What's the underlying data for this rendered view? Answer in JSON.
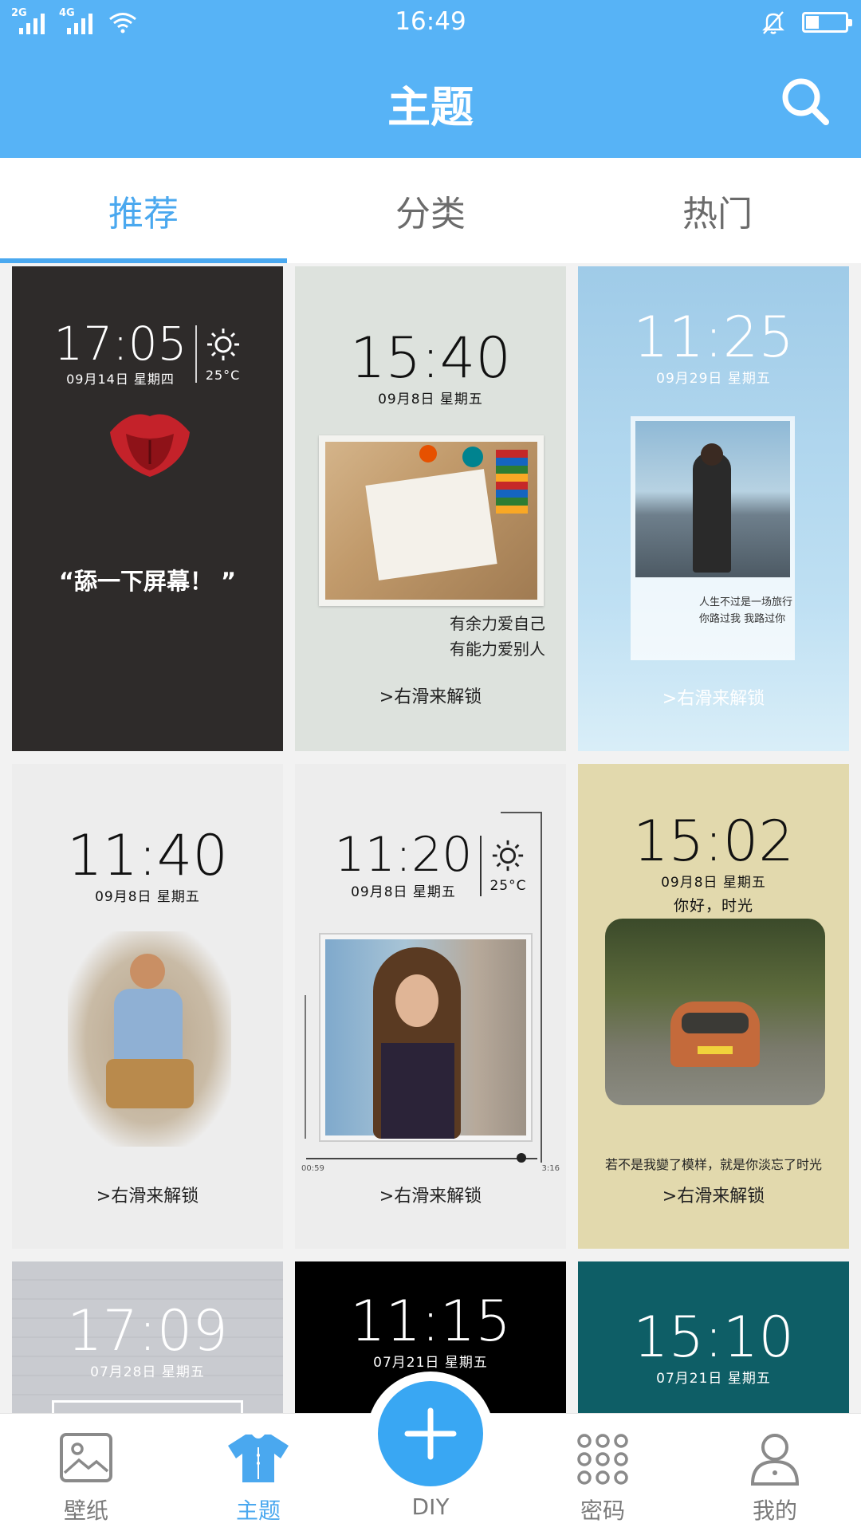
{
  "status_bar": {
    "sig1": "2G",
    "sig2": "4G",
    "time": "16:49"
  },
  "header": {
    "title": "主题"
  },
  "tabs": [
    {
      "label": "推荐",
      "active": true
    },
    {
      "label": "分类",
      "active": false
    },
    {
      "label": "热门",
      "active": false
    }
  ],
  "themes": [
    {
      "time": "17:05",
      "date": "09月14日  星期四",
      "weather": "25°C",
      "caption": "“舔一下屏幕！ ”"
    },
    {
      "time": "15:40",
      "date": "09月8日  星期五",
      "quote_line1": "有余力爱自己",
      "quote_line2": "有能力爱别人",
      "unlock": ">右滑来解锁"
    },
    {
      "time": "11:25",
      "date": "09月29日  星期五",
      "quote_line1": "人生不过是一场旅行",
      "quote_line2": "你路过我 我路过你",
      "unlock": ">右滑来解锁"
    },
    {
      "time": "11:40",
      "date": "09月8日  星期五",
      "unlock": ">右滑来解锁"
    },
    {
      "time": "11:20",
      "date": "09月8日  星期五",
      "weather": "25°C",
      "track_start": "00:59",
      "track_end": "3:16",
      "unlock": ">右滑来解锁"
    },
    {
      "time": "15:02",
      "date": "09月8日  星期五",
      "greeting": "你好，时光",
      "quote_line1": "若不是我變了模样，就是你淡忘了时光",
      "unlock": ">右滑来解锁"
    },
    {
      "time": "17:09",
      "date": "07月28日  星期五"
    },
    {
      "time": "11:15",
      "date": "07月21日  星期五"
    },
    {
      "time": "15:10",
      "date": "07月21日  星期五"
    }
  ],
  "bottom_nav": {
    "wallpaper": "壁纸",
    "theme": "主题",
    "diy": "DIY",
    "password": "密码",
    "mine": "我的"
  },
  "colors": {
    "accent": "#57b3f6",
    "active": "#4aa8ef"
  }
}
